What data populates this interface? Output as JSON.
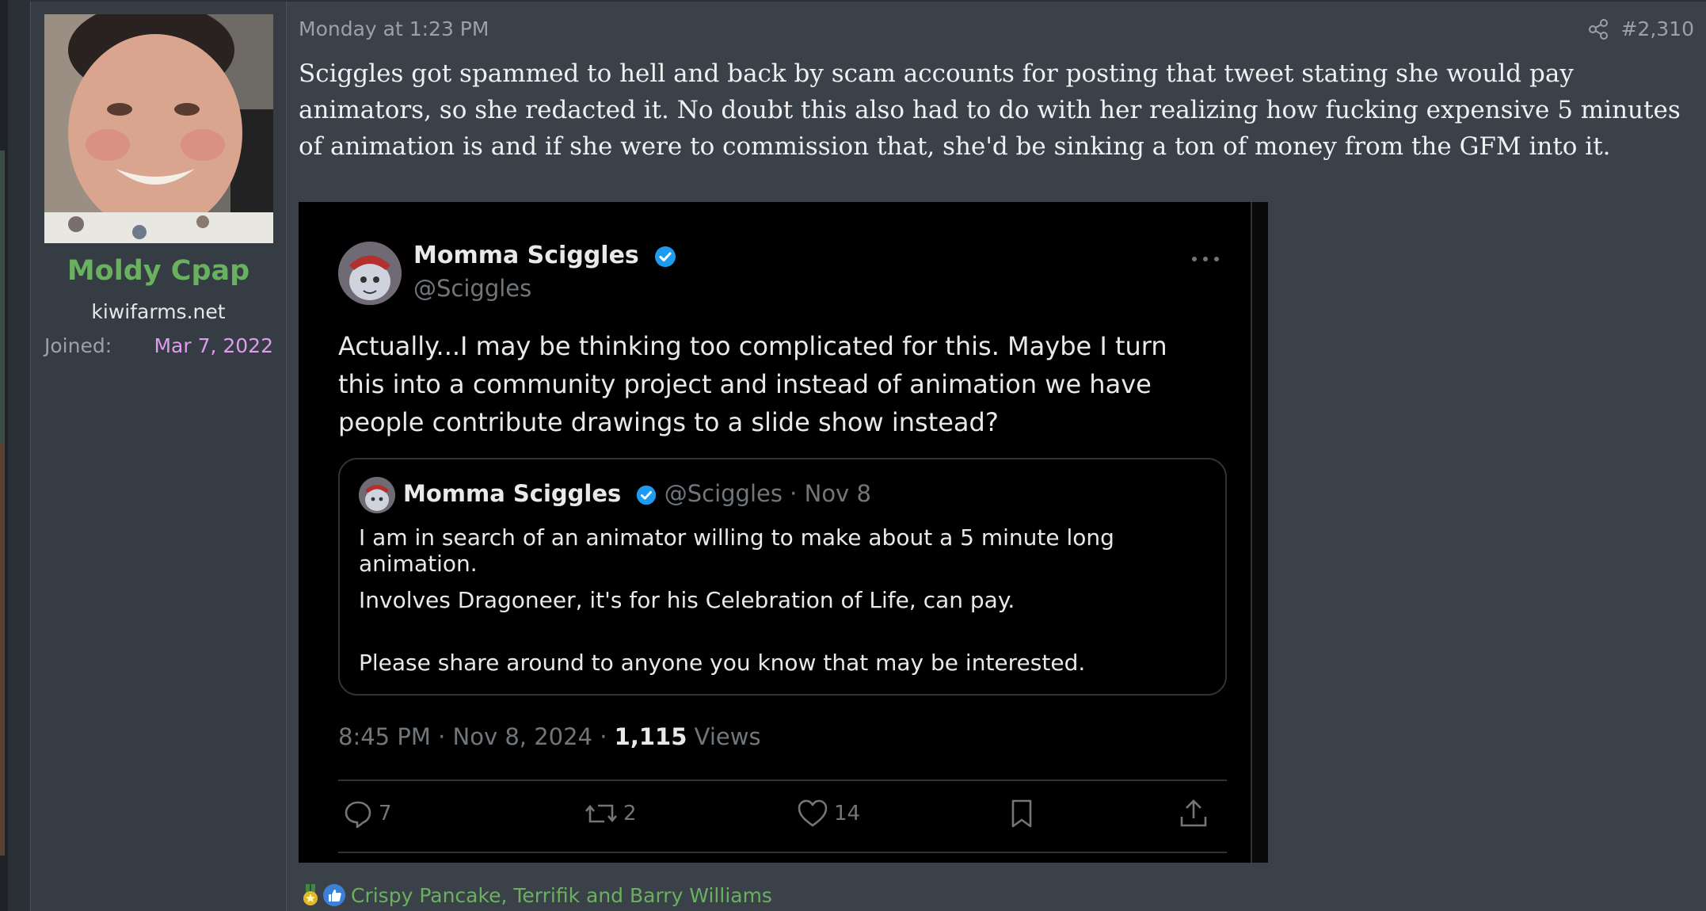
{
  "post": {
    "user": {
      "name": "Moldy Cpap",
      "title": "kiwifarms.net",
      "joined_label": "Joined:",
      "joined_value": "Mar 7, 2022"
    },
    "time": "Monday at 1:23 PM",
    "number": "#2,310",
    "body": "Sciggles got spammed to hell and back by scam accounts for posting that tweet stating she would pay animators, so she redacted it. No doubt this also had to do with her realizing how fucking expensive 5 minutes of animation is and if she were to commission that, she'd be sinking a ton of money from the GFM into it."
  },
  "tweet": {
    "name": "Momma Sciggles",
    "handle": "@Sciggles",
    "text": "Actually...I may be thinking too complicated for this. Maybe I turn this into a community project and instead of animation we have people contribute drawings to a slide show instead?",
    "quote": {
      "name": "Momma Sciggles",
      "handle_date": "@Sciggles · Nov 8",
      "line1": "I am in search of an animator willing to make about a 5 minute long animation.",
      "line2": "Involves Dragoneer, it's for his Celebration of Life, can pay.",
      "line3": "Please share around to anyone you know that may be interested."
    },
    "timestamp": "8:45 PM · Nov 8, 2024 · ",
    "views_count": "1,115",
    "views_label": " Views",
    "replies": "7",
    "reposts": "2",
    "likes": "14"
  },
  "reactions": {
    "users": "Crispy Pancake, Terrifik and Barry Williams"
  },
  "colors": {
    "page_bg": "#2b2f36",
    "post_bg": "#3b4149",
    "username": "#6ab15f",
    "joined_date": "#e19af0",
    "tweet_bg": "#000000",
    "verified": "#1d9bf0"
  }
}
